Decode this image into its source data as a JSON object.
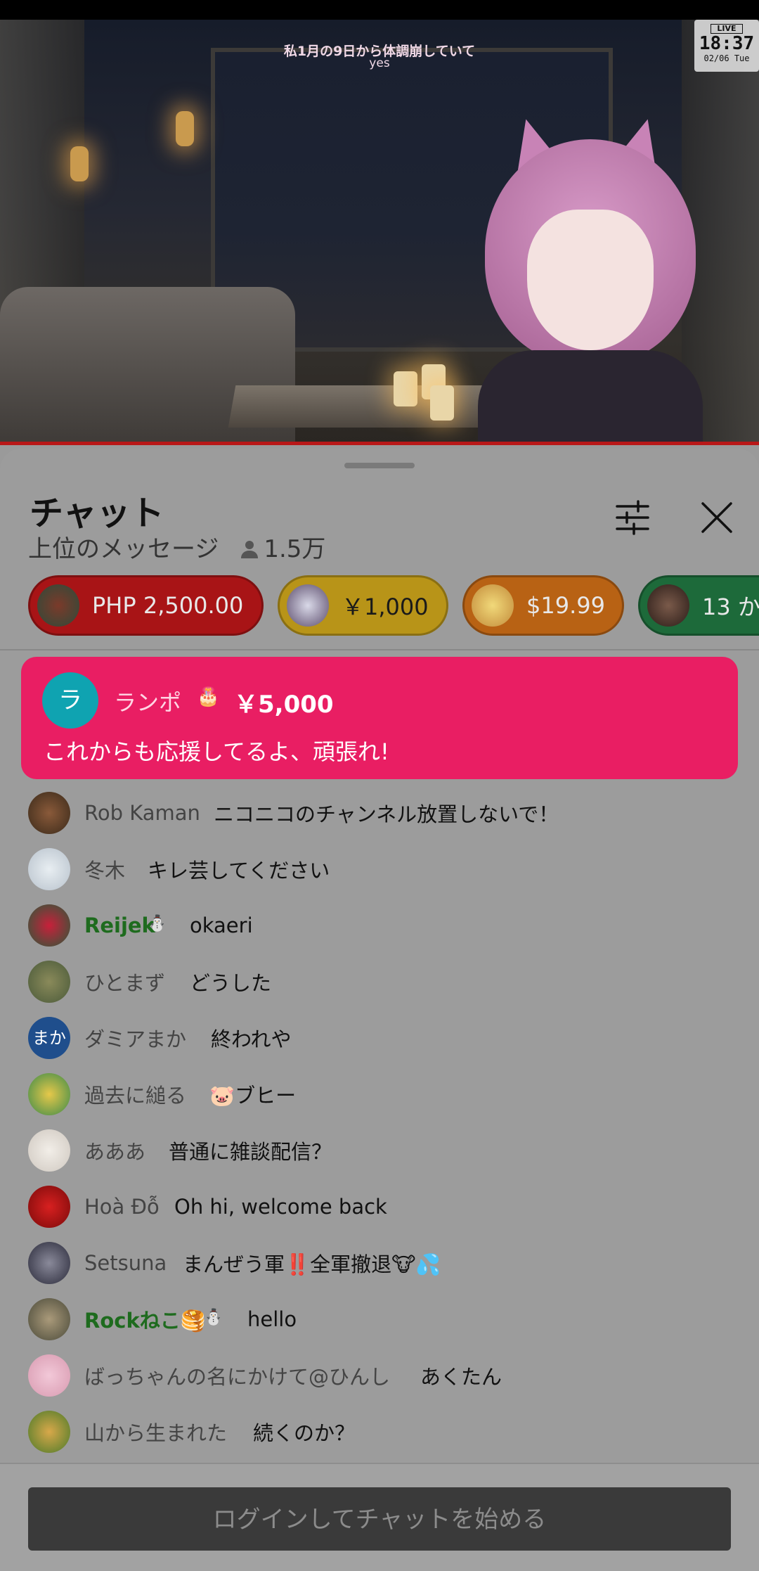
{
  "video": {
    "caption_line1": "私1月の9日から体調崩していて",
    "caption_line2": "yes",
    "live_tag": "LIVE",
    "clock_time": "18:37",
    "clock_date": "02/06 Tue"
  },
  "chat_panel": {
    "title": "チャット",
    "mode_label": "上位のメッセージ",
    "viewer_count": "1.5万",
    "settings_icon": "sliders-icon",
    "close_icon": "close-icon"
  },
  "pinned_supers": [
    {
      "amount": "PHP 2,500.00",
      "color": "#a81416"
    },
    {
      "amount": "￥1,000",
      "color": "#b89418"
    },
    {
      "amount": "$19.99",
      "color": "#b86214"
    },
    {
      "amount": "13 か",
      "color": "#1d6a3a"
    }
  ],
  "superchat": {
    "avatar_letter": "ラ",
    "name": "ランポ",
    "badge": "🎂",
    "amount": "￥5,000",
    "message": "これからも応援してるよ、頑張れ!",
    "color": "#e91e63"
  },
  "messages": [
    {
      "name": "Rob Kaman",
      "text": "ニコニコのチャンネル放置しないで！"
    },
    {
      "name": "冬木",
      "text": "キレ芸してください"
    },
    {
      "name": "Reijek",
      "badge": "⛄",
      "text": "okaeri",
      "member": true
    },
    {
      "name": "ひとまず",
      "text": "どうした"
    },
    {
      "name": "ダミアまか",
      "avatar_text": "まか",
      "text": "終われや"
    },
    {
      "name": "過去に縋る",
      "text": "🐷ブヒー"
    },
    {
      "name": "あああ",
      "text": "普通に雑談配信？"
    },
    {
      "name": "Hoà Đỗ",
      "text": "Oh hi, welcome back"
    },
    {
      "name": "Setsuna",
      "text": "まんぜう軍‼️全軍撤退🐮💦"
    },
    {
      "name": "Rockねこ🥞",
      "badge": "⛄",
      "text": "hello",
      "member": true
    },
    {
      "name": "ばっちゃんの名にかけて@ひんし",
      "text": "あくたん"
    },
    {
      "name": "山から生まれた",
      "text": "続くのか？"
    }
  ],
  "footer": {
    "login_label": "ログインしてチャットを始める"
  }
}
